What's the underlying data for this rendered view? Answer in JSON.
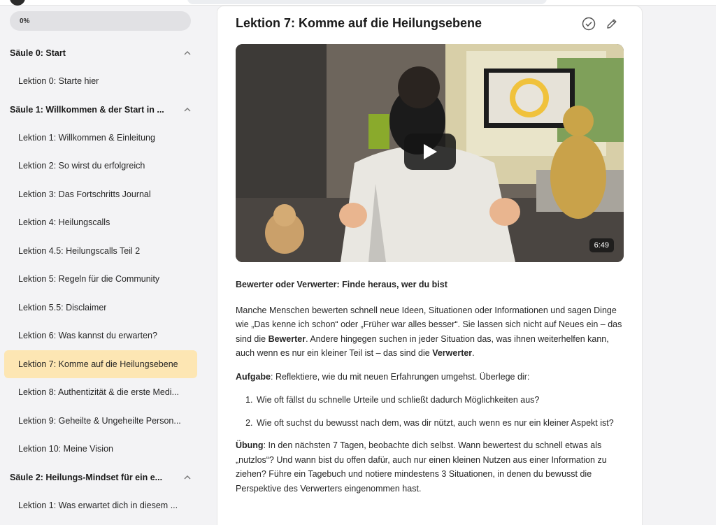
{
  "progress": {
    "label": "0%",
    "value": 0
  },
  "sidebar": {
    "sections": [
      {
        "title": "Säule 0: Start"
      },
      {
        "title": "Säule 1: Willkommen & der Start in ..."
      },
      {
        "title": "Säule 2: Heilungs-Mindset für ein e..."
      }
    ],
    "lessons": [
      {
        "label": "Lektion 0: Starte hier"
      },
      {
        "label": "Lektion 1: Willkommen & Einleitung"
      },
      {
        "label": "Lektion 2: So wirst du erfolgreich"
      },
      {
        "label": "Lektion 3: Das Fortschritts Journal"
      },
      {
        "label": "Lektion 4: Heilungscalls"
      },
      {
        "label": "Lektion 4.5: Heilungscalls Teil 2"
      },
      {
        "label": "Lektion 5: Regeln für die Community"
      },
      {
        "label": "Lektion 5.5: Disclaimer"
      },
      {
        "label": "Lektion 6: Was kannst du erwarten?"
      },
      {
        "label": "Lektion 7: Komme auf die Heilungsebene"
      },
      {
        "label": "Lektion 8: Authentizität & die erste Medi..."
      },
      {
        "label": "Lektion 9: Geheilte & Ungeheilte Person..."
      },
      {
        "label": "Lektion 10: Meine Vision"
      },
      {
        "label": "Lektion 1: Was erwartet dich in diesem ..."
      }
    ]
  },
  "main": {
    "title": "Lektion 7: Komme auf die Heilungsebene",
    "video": {
      "duration": "6:49"
    },
    "heading": "Bewerter oder Verwerter: Finde heraus, wer du bist",
    "p1_a": "Manche Menschen bewerten schnell neue Ideen, Situationen oder Informationen und sagen Dinge wie „Das kenne ich schon“ oder „Früher war alles besser“. Sie lassen sich nicht auf Neues ein – das sind die ",
    "p1_b": "Bewerter",
    "p1_c": ". Andere hingegen suchen in jeder Situation das, was ihnen weiterhelfen kann, auch wenn es nur ein kleiner Teil ist – das sind die ",
    "p1_d": "Verwerter",
    "p1_e": ".",
    "task_label": "Aufgabe",
    "task_text": ": Reflektiere, wie du mit neuen Erfahrungen umgehst. Überlege dir:",
    "questions": [
      "Wie oft fällst du schnelle Urteile und schließt dadurch Möglichkeiten aus?",
      "Wie oft suchst du bewusst nach dem, was dir nützt, auch wenn es nur ein kleiner Aspekt ist?"
    ],
    "exercise_label": "Übung",
    "exercise_text": ": In den nächsten 7 Tagen, beobachte dich selbst. Wann bewertest du schnell etwas als „nutzlos“? Und wann bist du offen dafür, auch nur einen kleinen Nutzen aus einer Information zu ziehen? Führe ein Tagebuch und notiere mindestens 3 Situationen, in denen du bewusst die Perspektive des Verwerters eingenommen hast."
  },
  "colors": {
    "active_lesson_bg": "#fde6b3",
    "page_bg": "#f3f3f5",
    "card_bg": "#ffffff"
  },
  "icons": [
    "avatar",
    "chevron-up-icon",
    "check-circle-icon",
    "pencil-icon",
    "play-icon"
  ]
}
